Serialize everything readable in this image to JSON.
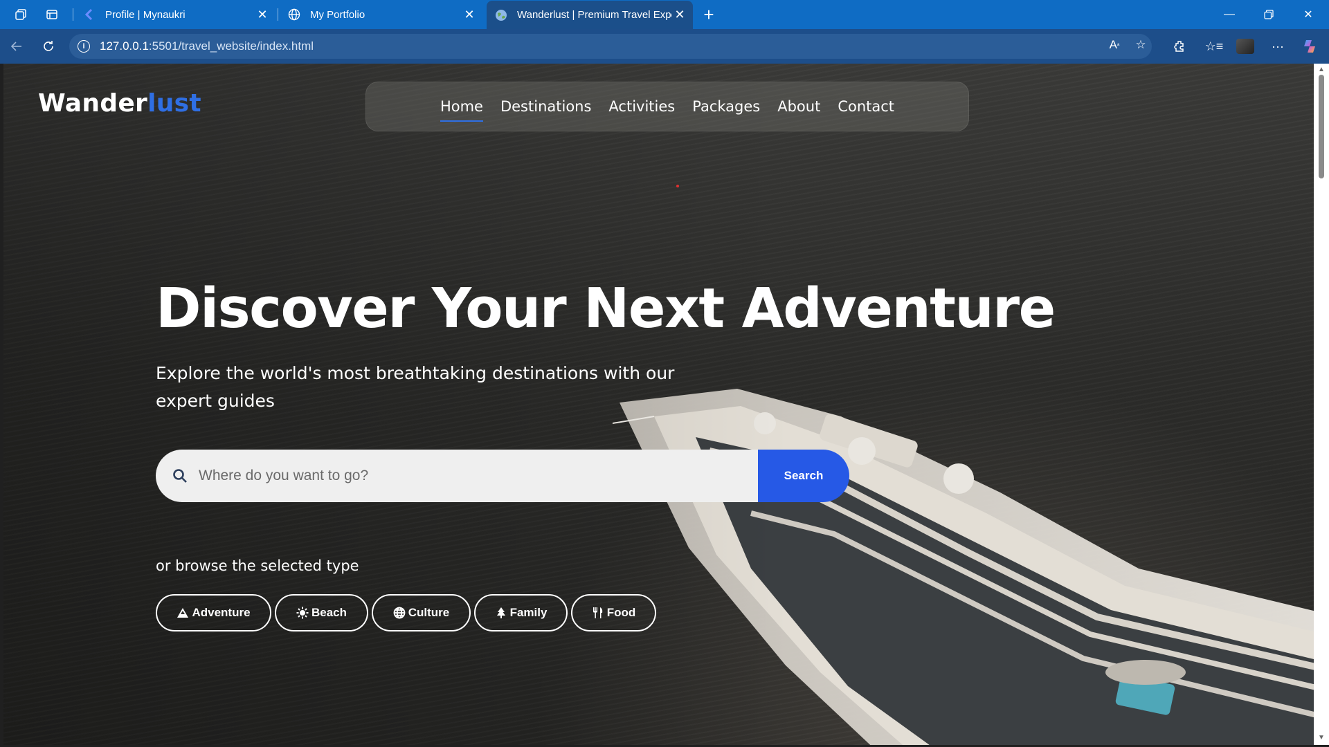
{
  "browser": {
    "tabs": [
      {
        "title": "Profile | Mynaukri",
        "active": false
      },
      {
        "title": "My Portfolio",
        "active": false
      },
      {
        "title": "Wanderlust | Premium Travel Expe",
        "active": true
      }
    ],
    "url_host": "127.0.0.1",
    "url_path": ":5501/travel_website/index.html"
  },
  "site": {
    "logo_main": "Wander",
    "logo_accent": "lust",
    "accent_color": "#2659e6",
    "nav": [
      "Home",
      "Destinations",
      "Activities",
      "Packages",
      "About",
      "Contact"
    ],
    "hero": {
      "title": "Discover Your Next Adventure",
      "subtitle": "Explore the world's most breathtaking destinations with our expert guides"
    },
    "search": {
      "placeholder": "Where do you want to go?",
      "button": "Search"
    },
    "browse": {
      "label": "or browse the selected type",
      "types": [
        {
          "label": "Adventure",
          "icon": "mountain-icon"
        },
        {
          "label": "Beach",
          "icon": "sun-icon"
        },
        {
          "label": "Culture",
          "icon": "globe-icon"
        },
        {
          "label": "Family",
          "icon": "tree-icon"
        },
        {
          "label": "Food",
          "icon": "utensils-icon"
        }
      ]
    }
  }
}
